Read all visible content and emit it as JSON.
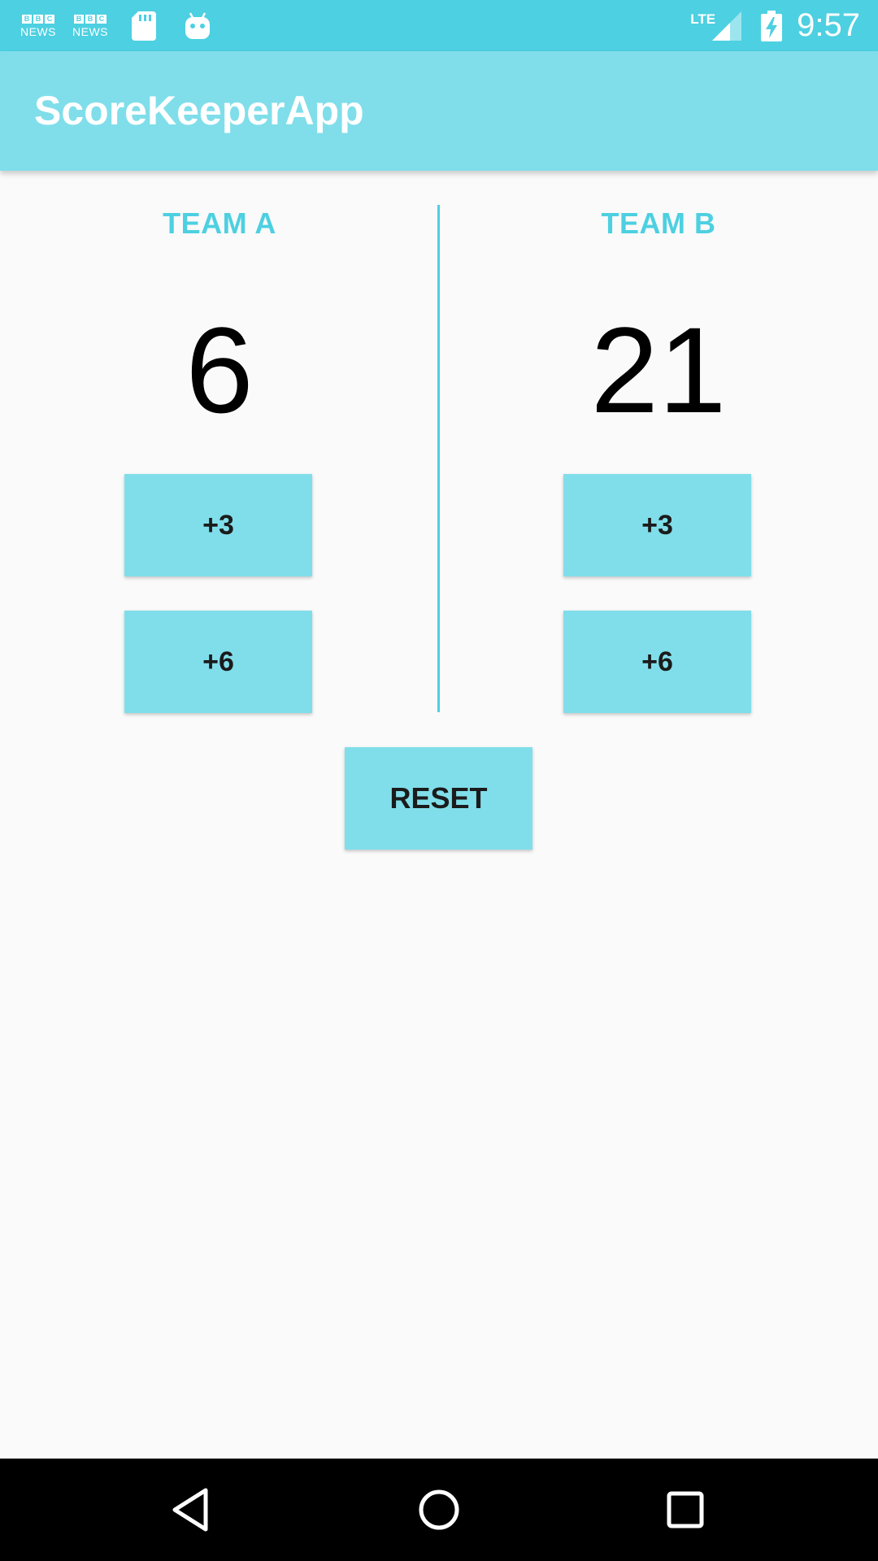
{
  "status_bar": {
    "notifications": [
      {
        "icon": "bbc-news-icon",
        "brand": "BBC",
        "label": "NEWS"
      },
      {
        "icon": "bbc-news-icon",
        "brand": "BBC",
        "label": "NEWS"
      },
      {
        "icon": "sd-card-icon"
      },
      {
        "icon": "android-icon"
      }
    ],
    "network": "LTE",
    "time": "9:57"
  },
  "app_bar": {
    "title": "ScoreKeeperApp"
  },
  "team_a": {
    "name": "TEAM A",
    "score": "6",
    "button_3": "+3",
    "button_6": "+6"
  },
  "team_b": {
    "name": "TEAM B",
    "score": "21",
    "button_3": "+3",
    "button_6": "+6"
  },
  "reset_label": "RESET",
  "colors": {
    "status_bar": "#4dd0e1",
    "app_bar": "#80deea",
    "accent": "#4dd0e1",
    "button": "#80deea",
    "background": "#fafafa"
  },
  "nav_bar": {
    "icons": [
      "back-icon",
      "home-icon",
      "recent-apps-icon"
    ]
  }
}
